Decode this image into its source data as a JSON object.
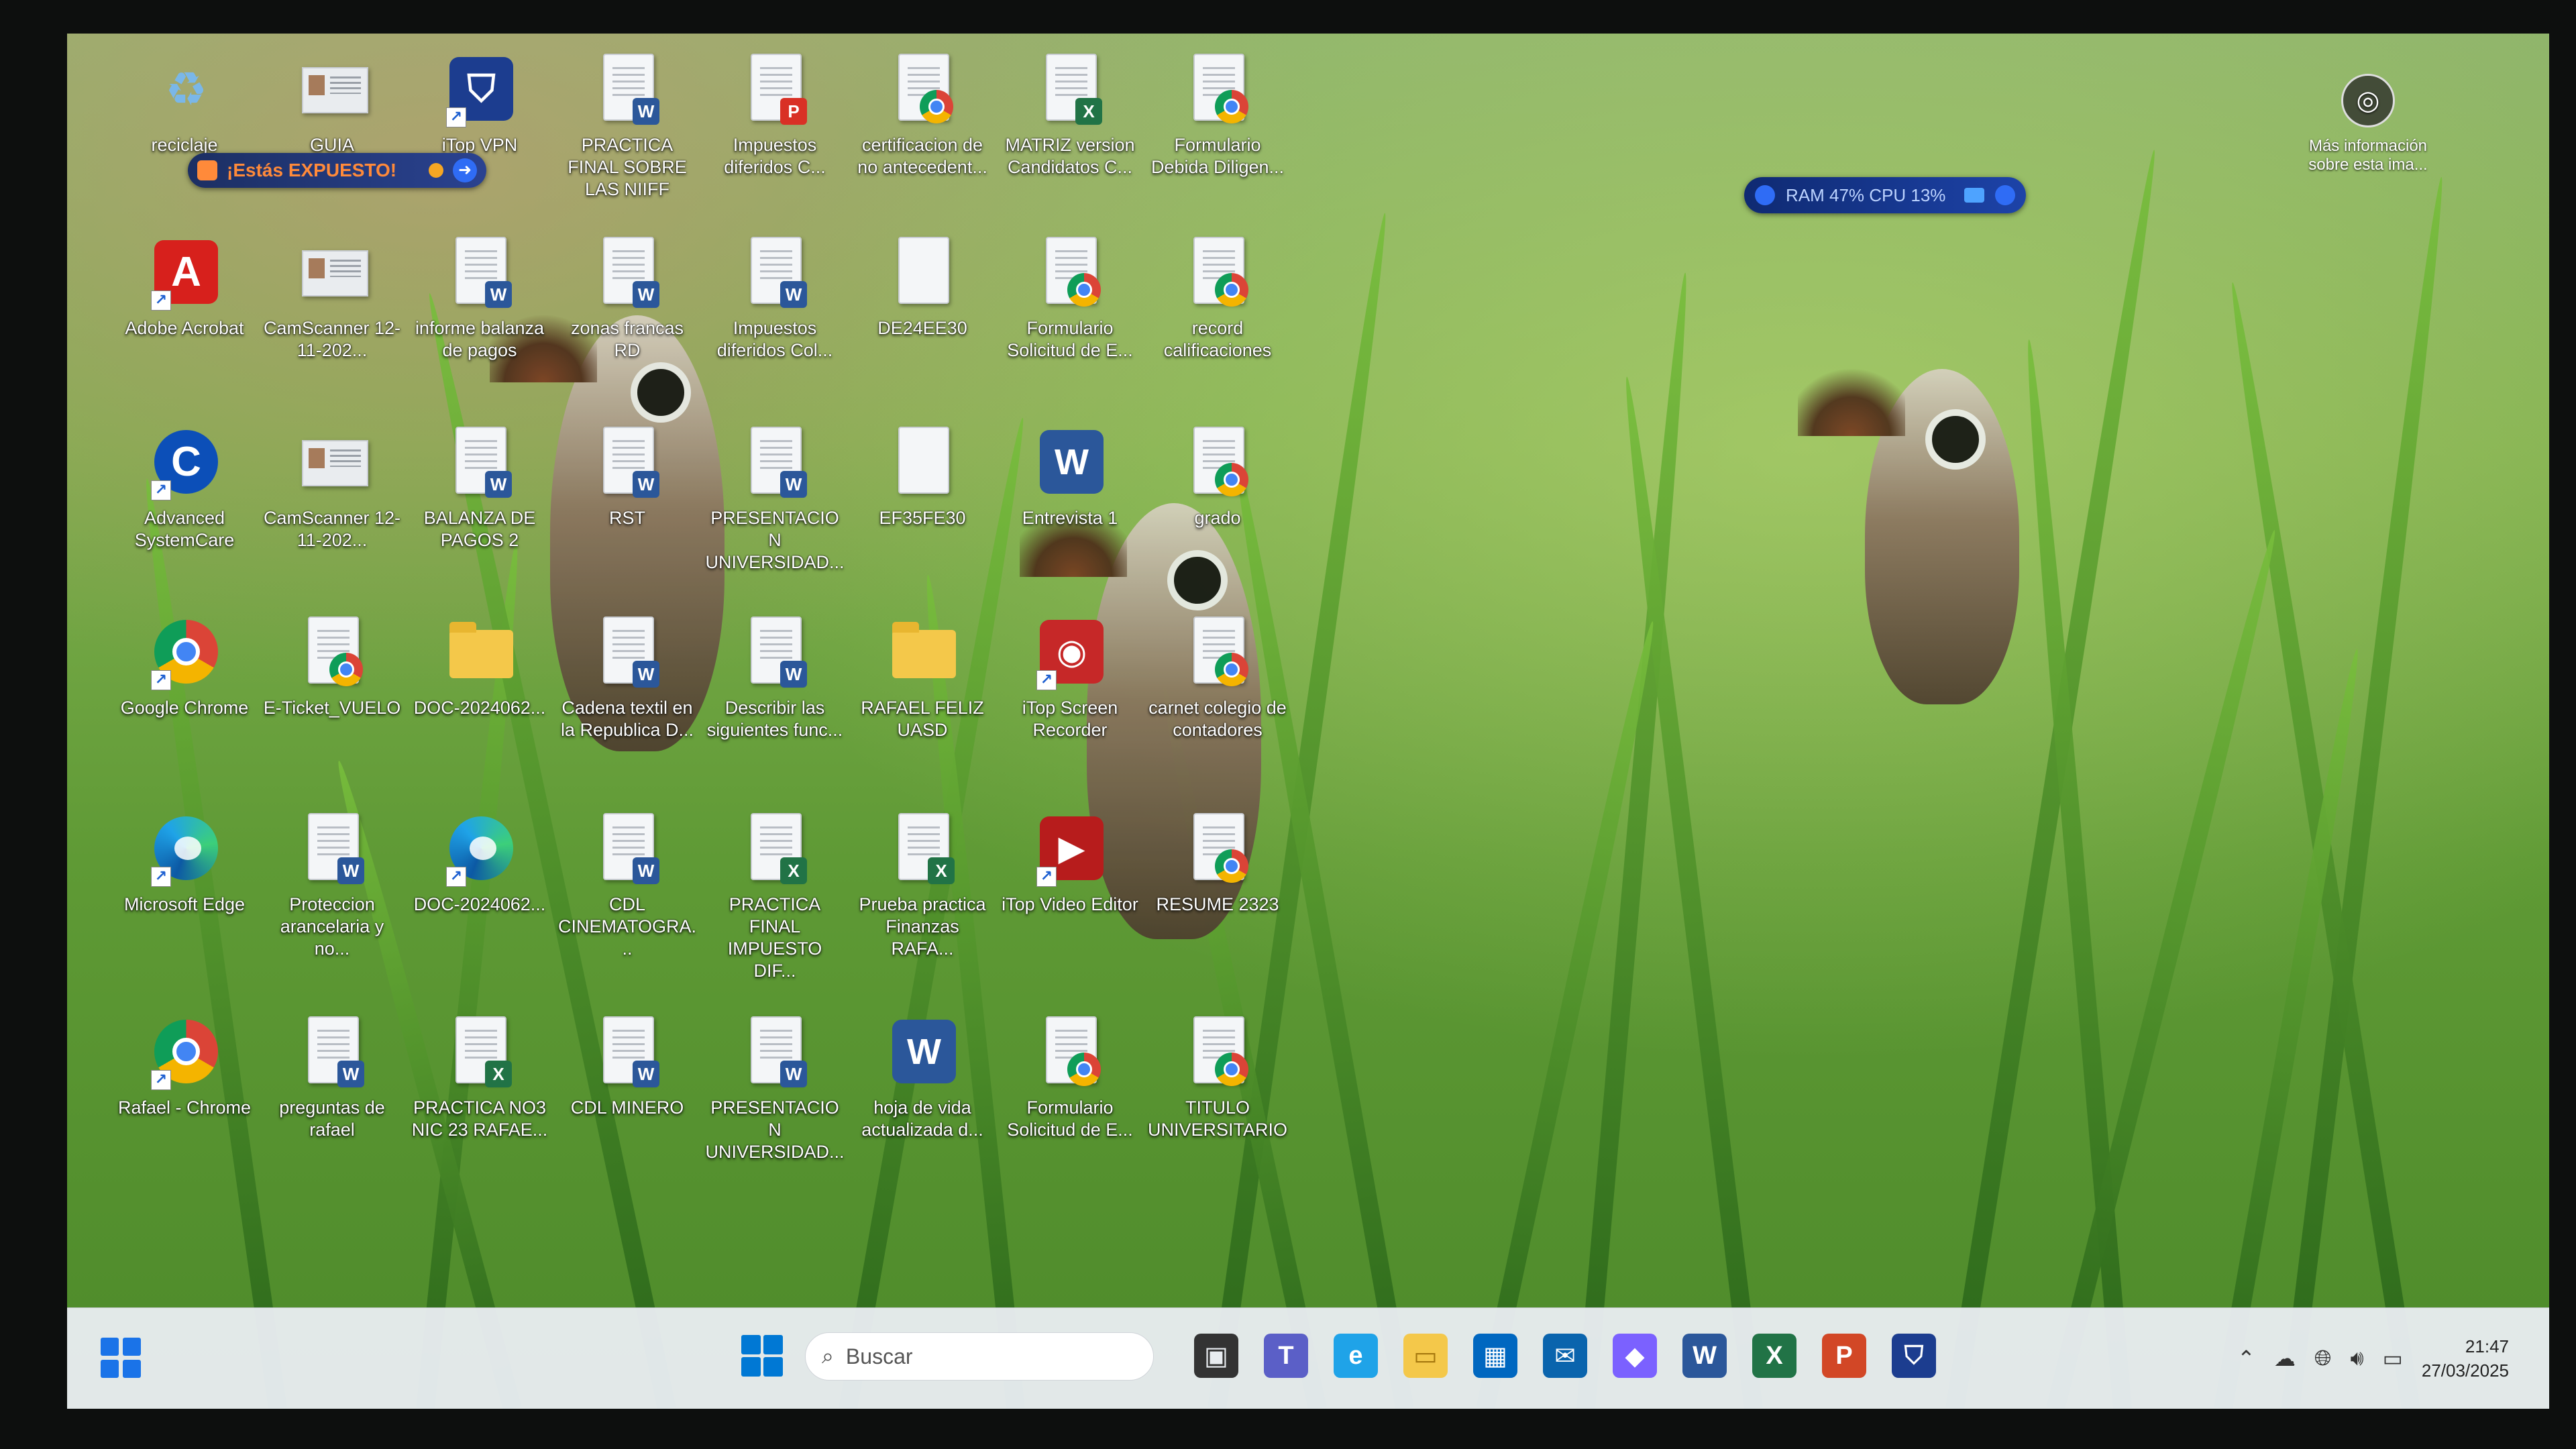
{
  "desktop": {
    "icons": [
      {
        "label": "reciclaje",
        "kind": "recycle"
      },
      {
        "label": "GUIA MODELO...",
        "kind": "scan"
      },
      {
        "label": "iTop VPN",
        "kind": "vpn"
      },
      {
        "label": "PRACTICA FINAL SOBRE LAS NIIFF",
        "kind": "word"
      },
      {
        "label": "Impuestos diferidos C...",
        "kind": "pdf"
      },
      {
        "label": "certificacion de no antecedent...",
        "kind": "chrome-doc"
      },
      {
        "label": "MATRIZ version Candidatos C...",
        "kind": "excel"
      },
      {
        "label": "Formulario Debida Diligen...",
        "kind": "chrome-doc"
      },
      {
        "label": "Adobe Acrobat",
        "kind": "acrobat"
      },
      {
        "label": "CamScanner 12-11-202...",
        "kind": "scan"
      },
      {
        "label": "informe balanza de pagos",
        "kind": "word"
      },
      {
        "label": "zonas francas RD",
        "kind": "word"
      },
      {
        "label": "Impuestos diferidos Col...",
        "kind": "word"
      },
      {
        "label": "DE24EE30",
        "kind": "plain"
      },
      {
        "label": "Formulario Solicitud de E...",
        "kind": "chrome-doc"
      },
      {
        "label": "record calificaciones",
        "kind": "chrome-doc"
      },
      {
        "label": "Advanced SystemCare",
        "kind": "asc"
      },
      {
        "label": "CamScanner 12-11-202...",
        "kind": "scan"
      },
      {
        "label": "BALANZA DE PAGOS 2",
        "kind": "word"
      },
      {
        "label": "RST",
        "kind": "word"
      },
      {
        "label": "PRESENTACION UNIVERSIDAD...",
        "kind": "word"
      },
      {
        "label": "EF35FE30",
        "kind": "plain"
      },
      {
        "label": "Entrevista 1",
        "kind": "word-big"
      },
      {
        "label": "grado",
        "kind": "chrome-doc"
      },
      {
        "label": "Google Chrome",
        "kind": "chrome"
      },
      {
        "label": "E-Ticket_VUELO",
        "kind": "chrome-doc"
      },
      {
        "label": "DOC-2024062...",
        "kind": "folder-edge"
      },
      {
        "label": "Cadena textil en la Republica D...",
        "kind": "word"
      },
      {
        "label": "Describir las siguientes func...",
        "kind": "word"
      },
      {
        "label": "RAFAEL FELIZ UASD",
        "kind": "folder"
      },
      {
        "label": "iTop Screen Recorder",
        "kind": "recorder"
      },
      {
        "label": "carnet colegio de contadores",
        "kind": "chrome-doc"
      },
      {
        "label": "Microsoft Edge",
        "kind": "edge"
      },
      {
        "label": "Proteccion arancelaria y no...",
        "kind": "word"
      },
      {
        "label": "DOC-2024062...",
        "kind": "edge"
      },
      {
        "label": "CDL CINEMATOGRA...",
        "kind": "word"
      },
      {
        "label": "PRACTICA FINAL IMPUESTO DIF...",
        "kind": "excel"
      },
      {
        "label": "Prueba practica Finanzas RAFA...",
        "kind": "excel"
      },
      {
        "label": "iTop Video Editor",
        "kind": "video"
      },
      {
        "label": "RESUME 2323",
        "kind": "chrome-doc"
      },
      {
        "label": "Rafael - Chrome",
        "kind": "chrome-user"
      },
      {
        "label": "preguntas de rafael",
        "kind": "word"
      },
      {
        "label": "PRACTICA NO3 NIC 23 RAFAE...",
        "kind": "excel"
      },
      {
        "label": "CDL MINERO",
        "kind": "word"
      },
      {
        "label": "PRESENTACION UNIVERSIDAD...",
        "kind": "word"
      },
      {
        "label": "hoja de vida actualizada d...",
        "kind": "word-big"
      },
      {
        "label": "Formulario Solicitud de E...",
        "kind": "chrome-doc"
      },
      {
        "label": "TITULO UNIVERSITARIO",
        "kind": "chrome-doc"
      }
    ]
  },
  "vpn_banner": {
    "text": "¡Estás EXPUESTO!"
  },
  "ram_widget": {
    "text": "RAM 47%  CPU 13%"
  },
  "more_info": {
    "text": "Más información sobre esta ima..."
  },
  "taskbar": {
    "search_placeholder": "Buscar",
    "apps": [
      "file-explorer-icon",
      "teams-icon",
      "edge-icon",
      "folder-icon",
      "store-icon",
      "mail-icon",
      "m365-icon",
      "word-icon",
      "excel-icon",
      "powerpoint-icon",
      "itop-vpn-icon"
    ],
    "time": "21:47",
    "date": "27/03/2025"
  },
  "colors": {
    "word": "#2b579a",
    "excel": "#217346",
    "pdf": "#d93025",
    "accent": "#0078d4"
  }
}
